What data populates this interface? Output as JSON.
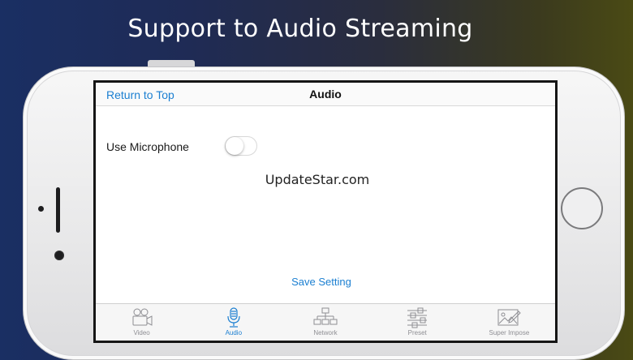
{
  "headline": "Support to Audio Streaming",
  "navbar": {
    "back_label": "Return to Top",
    "title": "Audio"
  },
  "settings": {
    "microphone_label": "Use Microphone",
    "microphone_enabled": false
  },
  "watermark": "UpdateStar.com",
  "save_label": "Save Setting",
  "tabs": [
    {
      "label": "Video",
      "icon": "video-camera-icon",
      "active": false
    },
    {
      "label": "Audio",
      "icon": "microphone-icon",
      "active": true
    },
    {
      "label": "Network",
      "icon": "network-icon",
      "active": false
    },
    {
      "label": "Preset",
      "icon": "sliders-icon",
      "active": false
    },
    {
      "label": "Super Impose",
      "icon": "image-edit-icon",
      "active": false
    }
  ],
  "colors": {
    "accent": "#1b7fd1",
    "inactive": "#8e8e93"
  }
}
